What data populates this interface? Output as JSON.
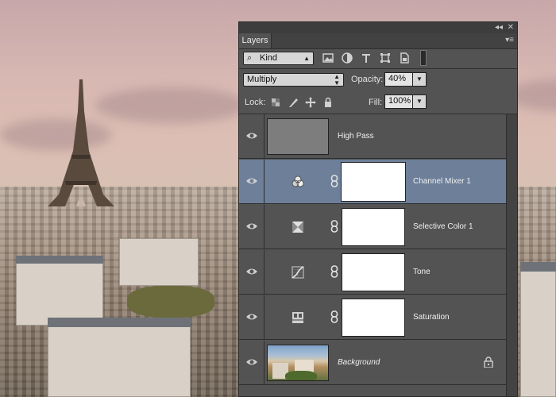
{
  "panel": {
    "title_controls": {
      "collapse_glyph": "◂◂",
      "close_glyph": "✕"
    },
    "tab_label": "Layers",
    "menu_glyph": "▾≡",
    "filter": {
      "kind_label": "Kind",
      "filter_icons": [
        "image-filter-icon",
        "adjustment-filter-icon",
        "type-filter-icon",
        "shape-filter-icon",
        "smart-object-filter-icon",
        "filter-toggle-icon"
      ]
    },
    "blend_mode": "Multiply",
    "opacity_label": "Opacity:",
    "opacity_value": "40%",
    "lock_label": "Lock:",
    "fill_label": "Fill:",
    "fill_value": "100%",
    "lock_icons": [
      "lock-transparent-icon",
      "lock-image-icon",
      "lock-position-icon",
      "lock-all-icon"
    ]
  },
  "layers": [
    {
      "name": "High Pass",
      "visible": true,
      "selected": false,
      "type": "pixel"
    },
    {
      "name": "Channel Mixer 1",
      "visible": true,
      "selected": true,
      "type": "adjustment",
      "icon": "channel-mixer-icon"
    },
    {
      "name": "Selective Color 1",
      "visible": true,
      "selected": false,
      "type": "adjustment",
      "icon": "selective-color-icon"
    },
    {
      "name": "Tone",
      "visible": true,
      "selected": false,
      "type": "adjustment",
      "icon": "curves-icon"
    },
    {
      "name": "Saturation",
      "visible": true,
      "selected": false,
      "type": "adjustment",
      "icon": "hue-saturation-icon"
    },
    {
      "name": "Background",
      "visible": true,
      "selected": false,
      "type": "background",
      "locked": true
    }
  ],
  "colors": {
    "panel_bg": "#535353",
    "selected_row": "#6d7f99",
    "text": "#f0f0f0"
  }
}
